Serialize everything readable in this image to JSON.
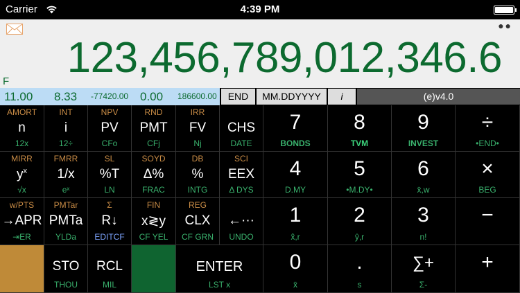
{
  "status_bar": {
    "carrier": "Carrier",
    "time": "4:39 PM",
    "battery_level": 1.0,
    "wifi_icon": "wifi-icon"
  },
  "display": {
    "main_value": "123,456,789,012,346.6",
    "flag": "F",
    "mail_icon": "mail-icon",
    "more_icon": "more-icon",
    "main_color": "#0c6a2f",
    "bg_color": "#efefef"
  },
  "registers": {
    "n": "11.00",
    "i": "8.33",
    "pv": "-77420.00",
    "pmt": "0.00",
    "fv": "186600.00",
    "bg_color": "#bcdcf5"
  },
  "modes": {
    "end": "END",
    "date_format": "MM.DDYYYY",
    "i_label": "i",
    "version": "(e)v4.0"
  },
  "colors": {
    "f_label": "#c98c46",
    "g_label": "#39b06c",
    "blue_label": "#7ea5ff",
    "f_key": "#bf8a38",
    "g_key": "#0f6430"
  },
  "keys": {
    "amort": {
      "f": "AMORT",
      "main": "n",
      "g": "12x"
    },
    "int": {
      "f": "INT",
      "main": "i",
      "g": "12÷"
    },
    "npv": {
      "f": "NPV",
      "main": "PV",
      "g": "CFo"
    },
    "rnd": {
      "f": "RND",
      "main": "PMT",
      "g": "CFj"
    },
    "irr": {
      "f": "IRR",
      "main": "FV",
      "g": "Nj"
    },
    "chs": {
      "f": "",
      "main": "CHS",
      "g": "DATE"
    },
    "seven": {
      "main": "7",
      "g": "BONDS"
    },
    "eight": {
      "main": "8",
      "g": "TVM"
    },
    "nine": {
      "main": "9",
      "g": "INVEST"
    },
    "divide": {
      "main": "÷",
      "g": "•END•"
    },
    "mirr": {
      "f": "MIRR",
      "main": "y",
      "main_sup": "x",
      "g": "√x"
    },
    "fmrr": {
      "f": "FMRR",
      "main": "1/x",
      "g": "eˣ"
    },
    "sl": {
      "f": "SL",
      "main": "%T",
      "g": "LN"
    },
    "soyd": {
      "f": "SOYD",
      "main": "Δ%",
      "g": "FRAC"
    },
    "db": {
      "f": "DB",
      "main": "%",
      "g": "INTG"
    },
    "sci": {
      "f": "SCI",
      "main": "EEX",
      "g": "Δ DYS"
    },
    "four": {
      "main": "4",
      "g": "D.MY"
    },
    "five": {
      "main": "5",
      "g": "•M.DY•"
    },
    "six": {
      "main": "6",
      "g": "x̄,w"
    },
    "times": {
      "main": "×",
      "g": "BEG"
    },
    "wpts": {
      "f": "w/PTS",
      "main": "→APR",
      "g": "⇥ER"
    },
    "pmtar": {
      "f": "PMTar",
      "main": "PMTa",
      "g": "YLDa"
    },
    "sigma": {
      "f": "Σ",
      "main": "R↓",
      "g": "EDITCF"
    },
    "fin": {
      "f": "FIN",
      "main": "x≷y",
      "g": "CF YEL"
    },
    "reg": {
      "f": "REG",
      "main": "CLX",
      "g": "CF GRN"
    },
    "undo": {
      "f": "",
      "main": "←···",
      "g": "UNDO"
    },
    "one": {
      "main": "1",
      "g": "x̂,r"
    },
    "two": {
      "main": "2",
      "g": "ŷ,r"
    },
    "three": {
      "main": "3",
      "g": "n!"
    },
    "minus": {
      "main": "−",
      "g": ""
    },
    "sto": {
      "main": "STO",
      "g": "THOU"
    },
    "rcl": {
      "main": "RCL",
      "g": "MIL"
    },
    "enter": {
      "main": "ENTER",
      "g": "LST x"
    },
    "zero": {
      "main": "0",
      "g": "x̄"
    },
    "dot": {
      "main": ".",
      "g": "s"
    },
    "sigma_plus": {
      "main": "∑+",
      "g": "Σ-"
    },
    "plus": {
      "main": "+",
      "g": ""
    }
  }
}
